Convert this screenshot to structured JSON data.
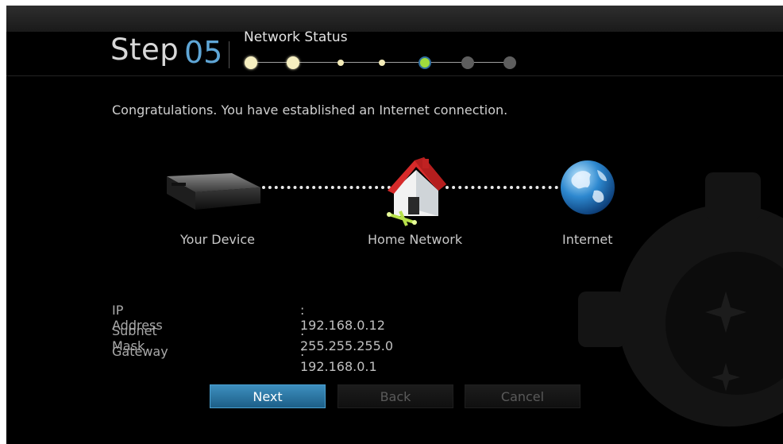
{
  "header": {
    "step_word": "Step",
    "step_number": "05",
    "title": "Network Status",
    "progress": {
      "total_steps": 7,
      "current_step": 5,
      "completed_steps": 4
    }
  },
  "message": "Congratulations. You have established an Internet connection.",
  "diagram": {
    "device_label": "Your Device",
    "home_label": "Home Network",
    "internet_label": "Internet"
  },
  "network_info": [
    {
      "label": "IP Address",
      "value": ": 192.168.0.12"
    },
    {
      "label": "Subnet Mask",
      "value": ": 255.255.255.0"
    },
    {
      "label": "Gateway",
      "value": ": 192.168.0.1"
    }
  ],
  "buttons": {
    "next": "Next",
    "back": "Back",
    "cancel": "Cancel"
  },
  "colors": {
    "accent_blue": "#5fa6d6",
    "current_step_green": "#9fdc3c",
    "button_blue": "#2a7aad"
  }
}
